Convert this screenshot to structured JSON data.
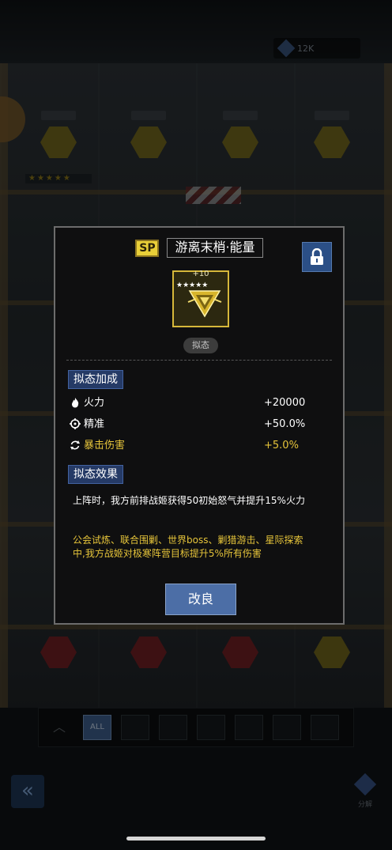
{
  "background": {
    "resource_value": "12K",
    "filter_all_label": "ALL",
    "decompose_label": "分解"
  },
  "modal": {
    "sp_badge": "SP",
    "title": "游离末梢·能量",
    "item_level": "+10",
    "item_stars": 5,
    "item_tag": "拟态",
    "bonus_section": "拟态加成",
    "stats": [
      {
        "name": "火力",
        "value": "+20000",
        "color": "#ffffff"
      },
      {
        "name": "精准",
        "value": "+50.0%",
        "color": "#ffffff"
      },
      {
        "name": "暴击伤害",
        "value": "+5.0%",
        "color": "#e6c43a"
      }
    ],
    "effect_section": "拟态效果",
    "effect_text": "上阵时，我方前排战姬获得50初始怒气并提升15%火力",
    "effect_text_gold": "公会试炼、联合围剿、世界boss、剿猎游击、星际探索中,我方战姬对极寒阵营目标提升5%所有伤害",
    "improve_button": "改良"
  },
  "colors": {
    "gold": "#e6c43a",
    "section_blue": "#253a66",
    "button_blue": "#4c6ea6"
  }
}
